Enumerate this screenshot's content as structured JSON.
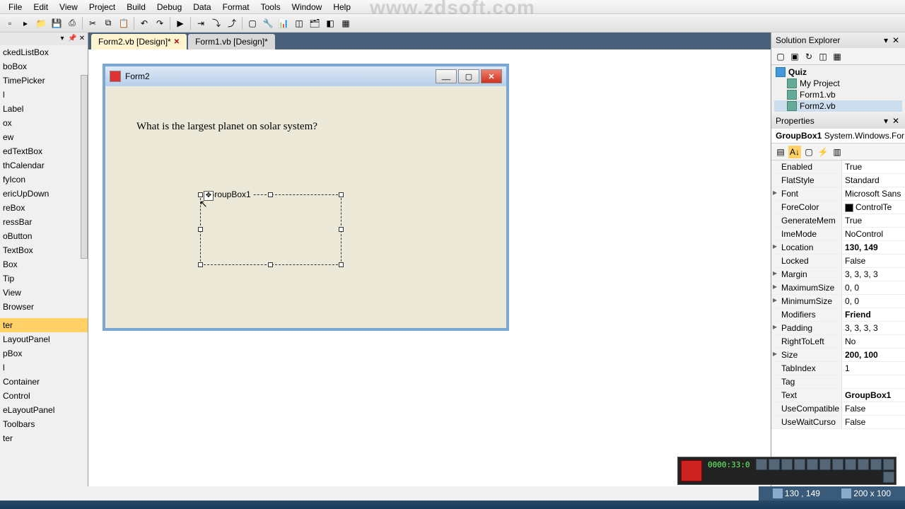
{
  "watermark": "www.zdsoft.com",
  "menu": [
    "File",
    "Edit",
    "View",
    "Project",
    "Build",
    "Debug",
    "Data",
    "Format",
    "Tools",
    "Window",
    "Help"
  ],
  "tabs": [
    {
      "label": "Form2.vb [Design]*",
      "active": true,
      "closable": true
    },
    {
      "label": "Form1.vb [Design]*",
      "active": false,
      "closable": false
    }
  ],
  "toolbox_items": [
    "ckedListBox",
    "boBox",
    "TimePicker",
    "l",
    "Label",
    "ox",
    "ew",
    "edTextBox",
    "thCalendar",
    "fyIcon",
    "ericUpDown",
    "reBox",
    "ressBar",
    "oButton",
    "TextBox",
    "Box",
    "Tip",
    "View",
    "Browser",
    "",
    "ter",
    "LayoutPanel",
    "pBox",
    "l",
    "Container",
    "Control",
    "eLayoutPanel",
    "Toolbars",
    "ter"
  ],
  "toolbox_selected_index": 20,
  "form": {
    "title": "Form2",
    "question": "What is the largest planet on solar system?",
    "groupbox_label": "GroupBox1"
  },
  "solution_explorer": {
    "title": "Solution Explorer",
    "root": "Quiz",
    "nodes": [
      "My Project",
      "Form1.vb",
      "Form2.vb"
    ],
    "selected": "Form2.vb"
  },
  "properties": {
    "title": "Properties",
    "object": "GroupBox1",
    "type": "System.Windows.For",
    "rows": [
      {
        "exp": "",
        "name": "Enabled",
        "value": "True",
        "bold": false
      },
      {
        "exp": "",
        "name": "FlatStyle",
        "value": "Standard",
        "bold": false
      },
      {
        "exp": "▸",
        "name": "Font",
        "value": "Microsoft Sans",
        "bold": false
      },
      {
        "exp": "",
        "name": "ForeColor",
        "value": "ControlTe",
        "bold": false,
        "color": true
      },
      {
        "exp": "",
        "name": "GenerateMem",
        "value": "True",
        "bold": false
      },
      {
        "exp": "",
        "name": "ImeMode",
        "value": "NoControl",
        "bold": false
      },
      {
        "exp": "▸",
        "name": "Location",
        "value": "130, 149",
        "bold": true
      },
      {
        "exp": "",
        "name": "Locked",
        "value": "False",
        "bold": false
      },
      {
        "exp": "▸",
        "name": "Margin",
        "value": "3, 3, 3, 3",
        "bold": false
      },
      {
        "exp": "▸",
        "name": "MaximumSize",
        "value": "0, 0",
        "bold": false
      },
      {
        "exp": "▸",
        "name": "MinimumSize",
        "value": "0, 0",
        "bold": false
      },
      {
        "exp": "",
        "name": "Modifiers",
        "value": "Friend",
        "bold": true
      },
      {
        "exp": "▸",
        "name": "Padding",
        "value": "3, 3, 3, 3",
        "bold": false
      },
      {
        "exp": "",
        "name": "RightToLeft",
        "value": "No",
        "bold": false
      },
      {
        "exp": "▸",
        "name": "Size",
        "value": "200, 100",
        "bold": true
      },
      {
        "exp": "",
        "name": "TabIndex",
        "value": "1",
        "bold": false
      },
      {
        "exp": "",
        "name": "Tag",
        "value": "",
        "bold": false
      },
      {
        "exp": "",
        "name": "Text",
        "value": "GroupBox1",
        "bold": true
      },
      {
        "exp": "",
        "name": "UseCompatible",
        "value": "False",
        "bold": false
      },
      {
        "exp": "",
        "name": "UseWaitCurso",
        "value": "False",
        "bold": false
      }
    ]
  },
  "status": {
    "pos": "130 , 149",
    "size": "200 x 100"
  },
  "tray_timer": "0000:33:0"
}
